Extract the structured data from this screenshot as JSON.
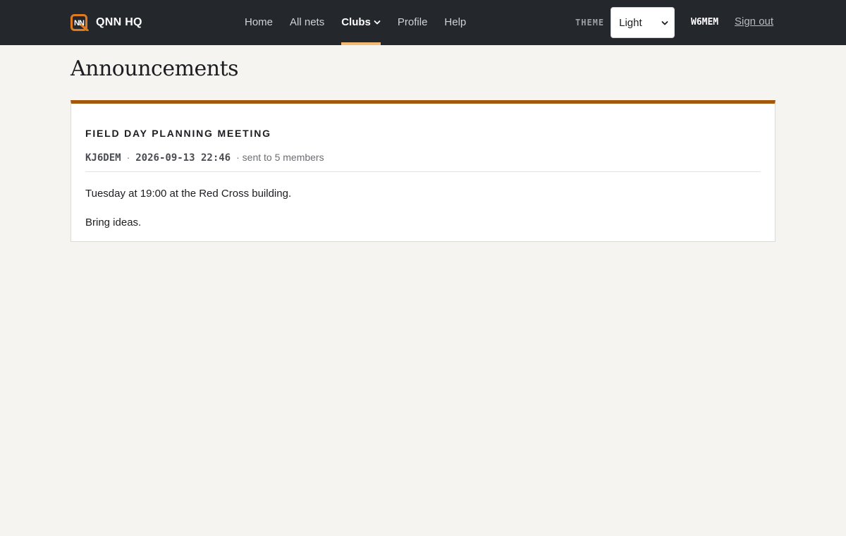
{
  "header": {
    "brand_name": "QNN HQ",
    "nav": [
      {
        "label": "Home",
        "active": false
      },
      {
        "label": "All nets",
        "active": false
      },
      {
        "label": "Clubs",
        "active": true,
        "has_dropdown": true
      },
      {
        "label": "Profile",
        "active": false
      },
      {
        "label": "Help",
        "active": false
      }
    ],
    "theme_label": "THEME",
    "theme_selected": "Light",
    "user_callsign": "W6MEM",
    "signout_label": "Sign out"
  },
  "page": {
    "title": "Announcements"
  },
  "announcement": {
    "title": "FIELD DAY PLANNING MEETING",
    "author": "KJ6DEM",
    "separator": "·",
    "datetime": "2026-09-13 22:46",
    "recipients_text": "· sent to 5 members",
    "body": [
      "Tuesday at 19:00 at the Red Cross building.",
      "Bring ideas."
    ]
  },
  "colors": {
    "header_bg": "#24272c",
    "active_underline": "#f3ba74",
    "card_accent": "#a2590c",
    "logo_accent": "#e07a1f",
    "page_bg": "#f5f4f0"
  },
  "icons": {
    "logo": "qnn-logo-icon",
    "dropdown": "chevron-down-icon",
    "select": "select-arrows-icon"
  }
}
